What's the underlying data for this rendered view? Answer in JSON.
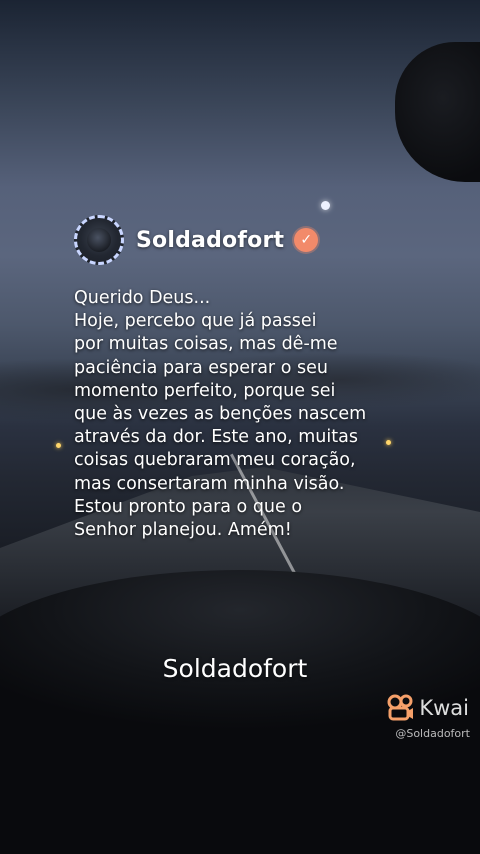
{
  "profile": {
    "username": "Soldadofort",
    "verified_symbol": "✓",
    "avatar_icon": "avatar-image",
    "badge_icon": "verified-badge-icon",
    "badge_color": "#f28a6a"
  },
  "message": {
    "lines": [
      "Querido Deus...",
      "Hoje, percebo que já passei",
      "por muitas coisas, mas dê-me",
      "paciência para esperar o seu",
      "momento perfeito, porque sei",
      "que às vezes as benções nascem",
      "através da dor. Este ano, muitas",
      "coisas quebraram meu coração,",
      "mas consertaram minha visão.",
      "Estou pronto para o que o",
      "Senhor planejou. Amém!"
    ]
  },
  "caption": {
    "text": "Soldadofort"
  },
  "watermark": {
    "brand": "Kwai",
    "handle": "@Soldadofort",
    "icon": "kwai-logo-icon",
    "color": "#f5a06a"
  }
}
